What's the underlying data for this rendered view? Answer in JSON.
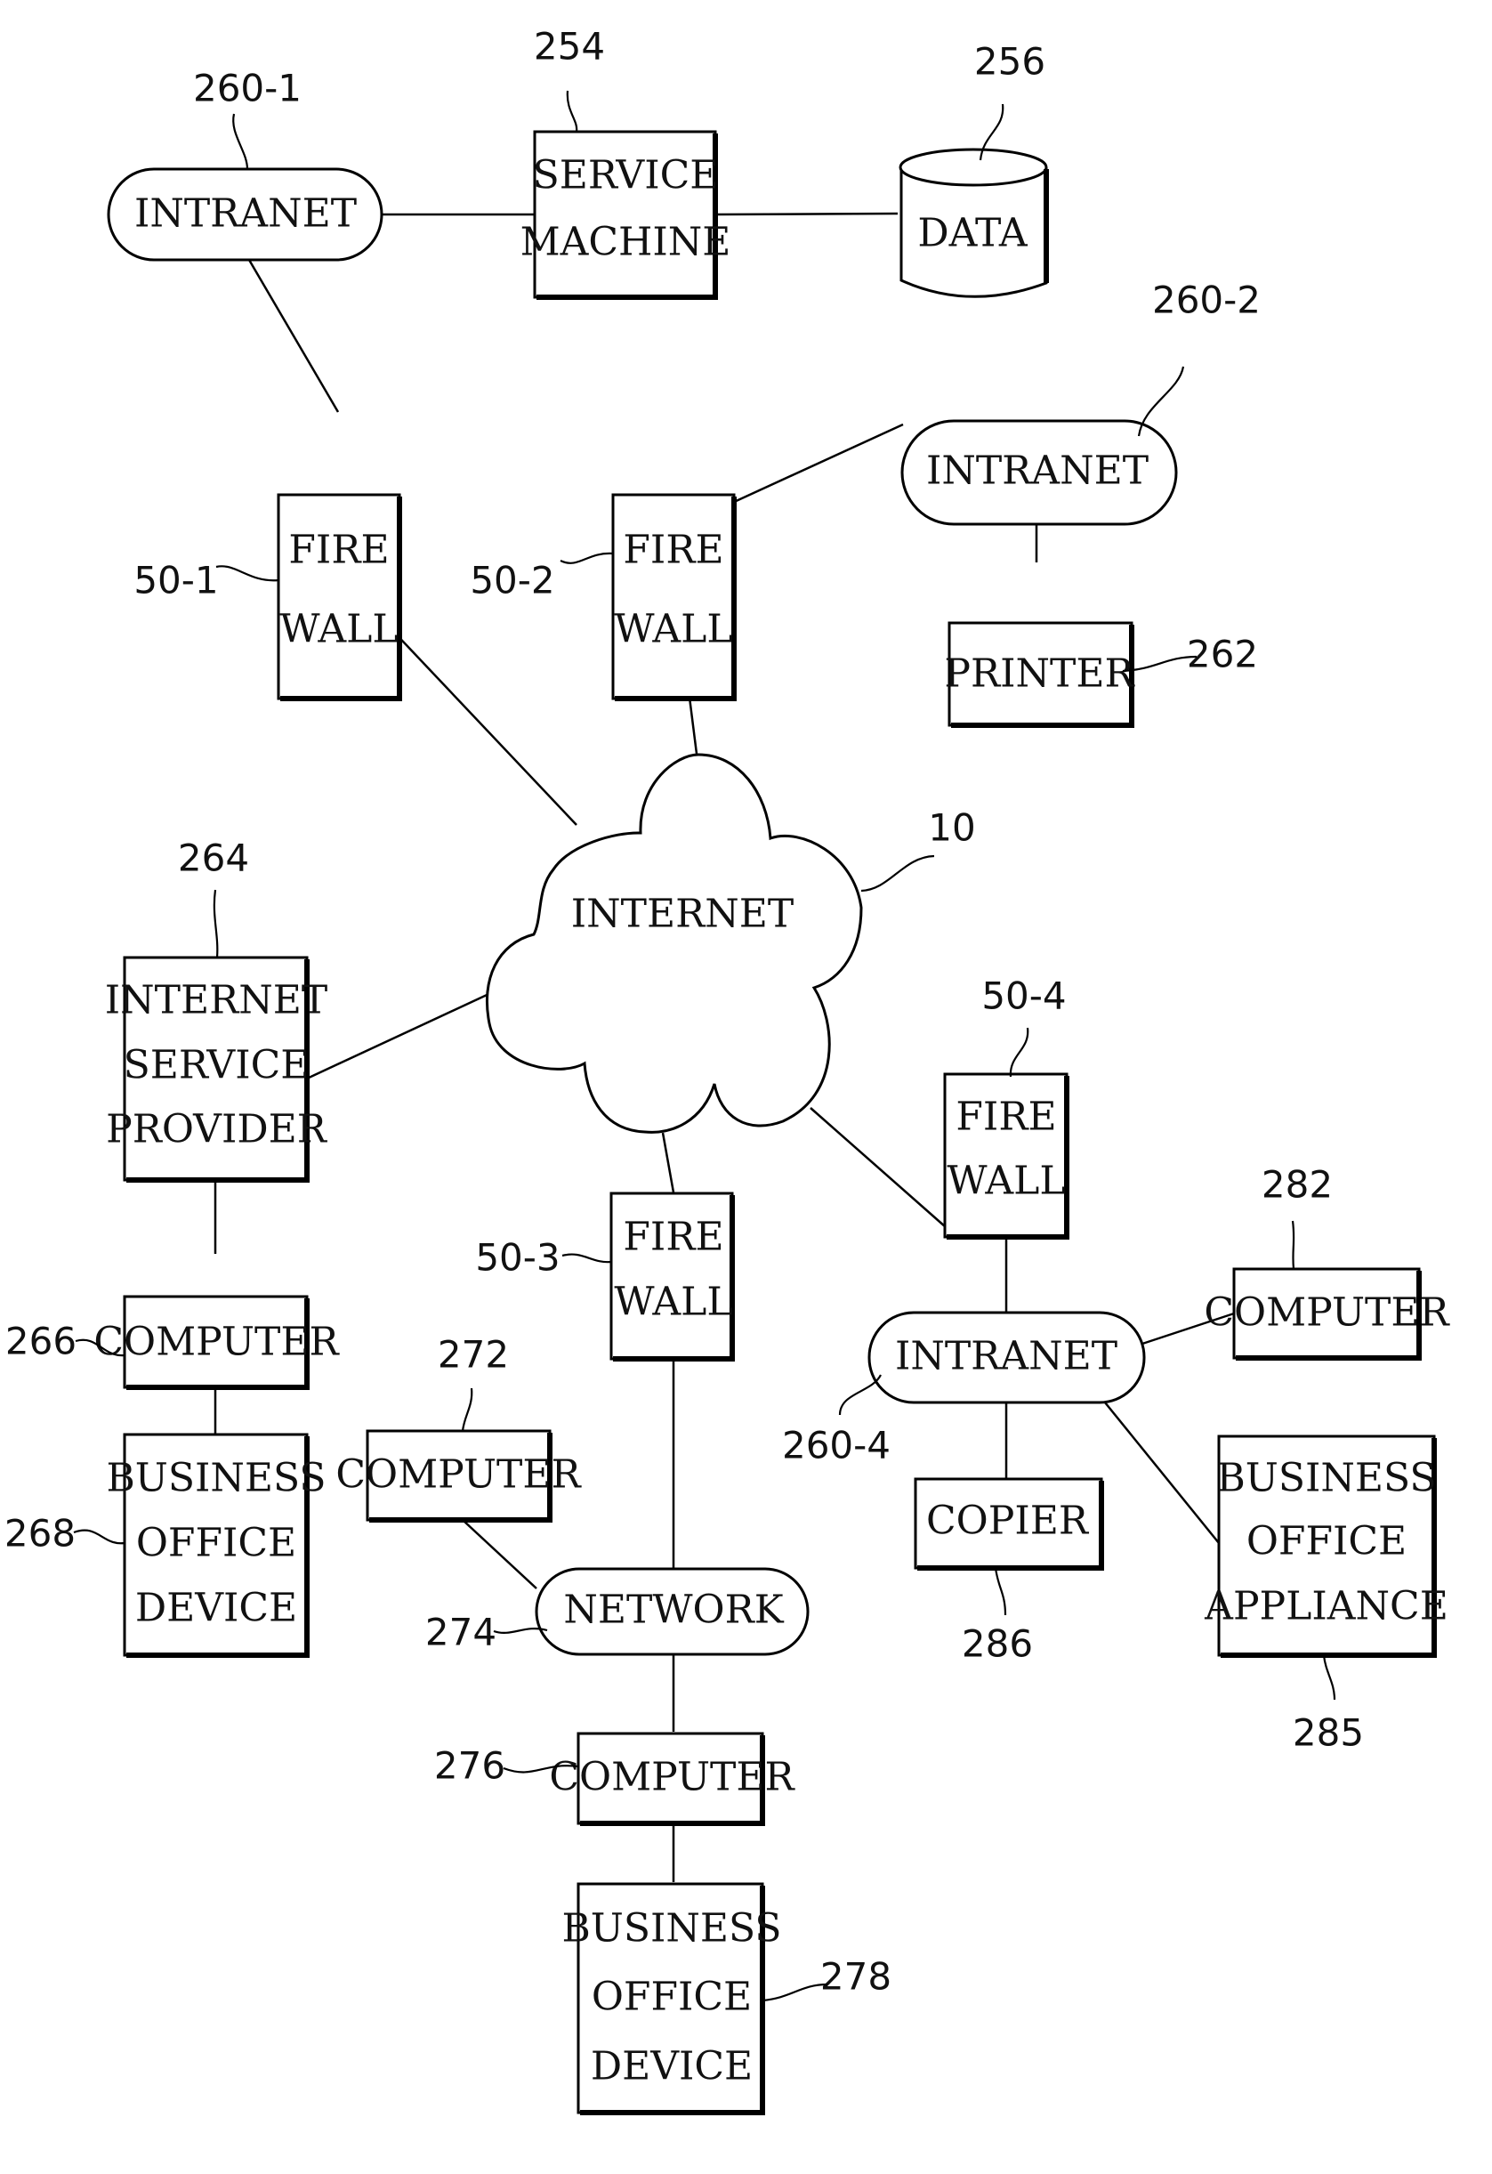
{
  "diagram": {
    "type": "network-block-diagram",
    "nodes": {
      "intranet1": {
        "label": "INTRANET",
        "ref": "260-1",
        "shape": "pill"
      },
      "service": {
        "lines": [
          "SERVICE",
          "MACHINE"
        ],
        "ref": "254",
        "shape": "box"
      },
      "data": {
        "label": "DATA",
        "ref": "256",
        "shape": "cylinder"
      },
      "fw1": {
        "lines": [
          "FIRE",
          "WALL"
        ],
        "ref": "50-1",
        "shape": "box"
      },
      "fw2": {
        "lines": [
          "FIRE",
          "WALL"
        ],
        "ref": "50-2",
        "shape": "box"
      },
      "intranet2": {
        "label": "INTRANET",
        "ref": "260-2",
        "shape": "pill"
      },
      "printer": {
        "label": "PRINTER",
        "ref": "262",
        "shape": "box"
      },
      "internet": {
        "label": "INTERNET",
        "ref": "10",
        "shape": "cloud"
      },
      "isp": {
        "lines": [
          "INTERNET",
          "SERVICE",
          "PROVIDER"
        ],
        "ref": "264",
        "shape": "box"
      },
      "comp266": {
        "label": "COMPUTER",
        "ref": "266",
        "shape": "box"
      },
      "bod268": {
        "lines": [
          "BUSINESS",
          "OFFICE",
          "DEVICE"
        ],
        "ref": "268",
        "shape": "box"
      },
      "fw3": {
        "lines": [
          "FIRE",
          "WALL"
        ],
        "ref": "50-3",
        "shape": "box"
      },
      "fw4": {
        "lines": [
          "FIRE",
          "WALL"
        ],
        "ref": "50-4",
        "shape": "box"
      },
      "intranet4": {
        "label": "INTRANET",
        "ref": "260-4",
        "shape": "pill"
      },
      "comp282": {
        "label": "COMPUTER",
        "ref": "282",
        "shape": "box"
      },
      "copier": {
        "label": "COPIER",
        "ref": "286",
        "shape": "box"
      },
      "boa285": {
        "lines": [
          "BUSINESS",
          "OFFICE",
          "APPLIANCE"
        ],
        "ref": "285",
        "shape": "box"
      },
      "comp272": {
        "label": "COMPUTER",
        "ref": "272",
        "shape": "box"
      },
      "network": {
        "label": "NETWORK",
        "ref": "274",
        "shape": "pill"
      },
      "comp276": {
        "label": "COMPUTER",
        "ref": "276",
        "shape": "box"
      },
      "bod278": {
        "lines": [
          "BUSINESS",
          "OFFICE",
          "DEVICE"
        ],
        "ref": "278",
        "shape": "box"
      }
    },
    "edges": [
      [
        "intranet1",
        "service"
      ],
      [
        "service",
        "data"
      ],
      [
        "intranet1",
        "fw1"
      ],
      [
        "fw1",
        "internet"
      ],
      [
        "fw2",
        "internet"
      ],
      [
        "fw2",
        "intranet2"
      ],
      [
        "intranet2",
        "printer"
      ],
      [
        "internet",
        "isp"
      ],
      [
        "isp",
        "comp266"
      ],
      [
        "comp266",
        "bod268"
      ],
      [
        "internet",
        "fw3"
      ],
      [
        "fw3",
        "network"
      ],
      [
        "comp272",
        "network"
      ],
      [
        "network",
        "comp276"
      ],
      [
        "comp276",
        "bod278"
      ],
      [
        "internet",
        "fw4"
      ],
      [
        "fw4",
        "intranet4"
      ],
      [
        "intranet4",
        "comp282"
      ],
      [
        "intranet4",
        "copier"
      ],
      [
        "intranet4",
        "boa285"
      ]
    ]
  }
}
